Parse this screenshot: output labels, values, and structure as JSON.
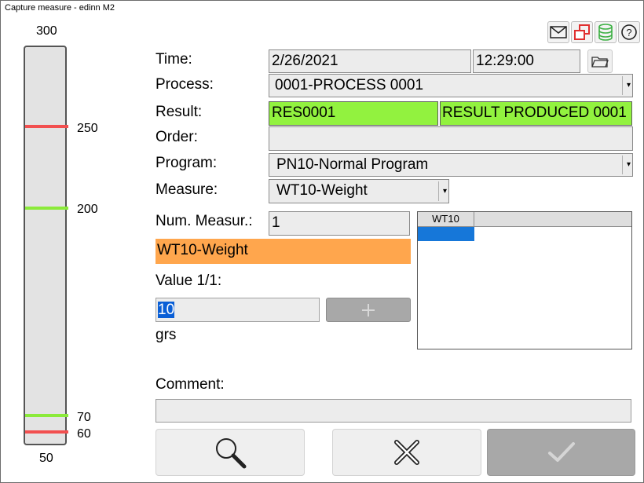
{
  "window": {
    "title": "Capture measure - edinn M2"
  },
  "gauge": {
    "max_label": "300",
    "min_label": "50",
    "ticks": [
      {
        "label": "250",
        "color": "#f25050"
      },
      {
        "label": "200",
        "color": "#8bea3a"
      },
      {
        "label": "70",
        "color": "#8bea3a"
      },
      {
        "label": "60",
        "color": "#f25050"
      }
    ]
  },
  "toolbar_icons": [
    "mail-icon",
    "windows-icon",
    "database-icon",
    "help-icon"
  ],
  "form": {
    "time_label": "Time:",
    "date_value": "2/26/2021",
    "time_value": "12:29:00",
    "process_label": "Process:",
    "process_value": "0001-PROCESS 0001",
    "result_label": "Result:",
    "result_code": "RES0001",
    "result_name": "RESULT PRODUCED 0001",
    "order_label": "Order:",
    "order_value": "",
    "program_label": "Program:",
    "program_value": "PN10-Normal Program",
    "measure_label": "Measure:",
    "measure_value": "WT10-Weight",
    "num_measur_label": "Num. Measur.:",
    "num_measur_value": "1",
    "measure_banner": "WT10-Weight",
    "value_label": "Value 1/1:",
    "value_input": "10",
    "unit": "grs",
    "comment_label": "Comment:",
    "comment_value": ""
  },
  "grid": {
    "column_header": "WT10"
  },
  "colors": {
    "highlight_green": "#92f23f",
    "banner_orange": "#ffa64d",
    "selection_blue": "#0a5fd6"
  }
}
